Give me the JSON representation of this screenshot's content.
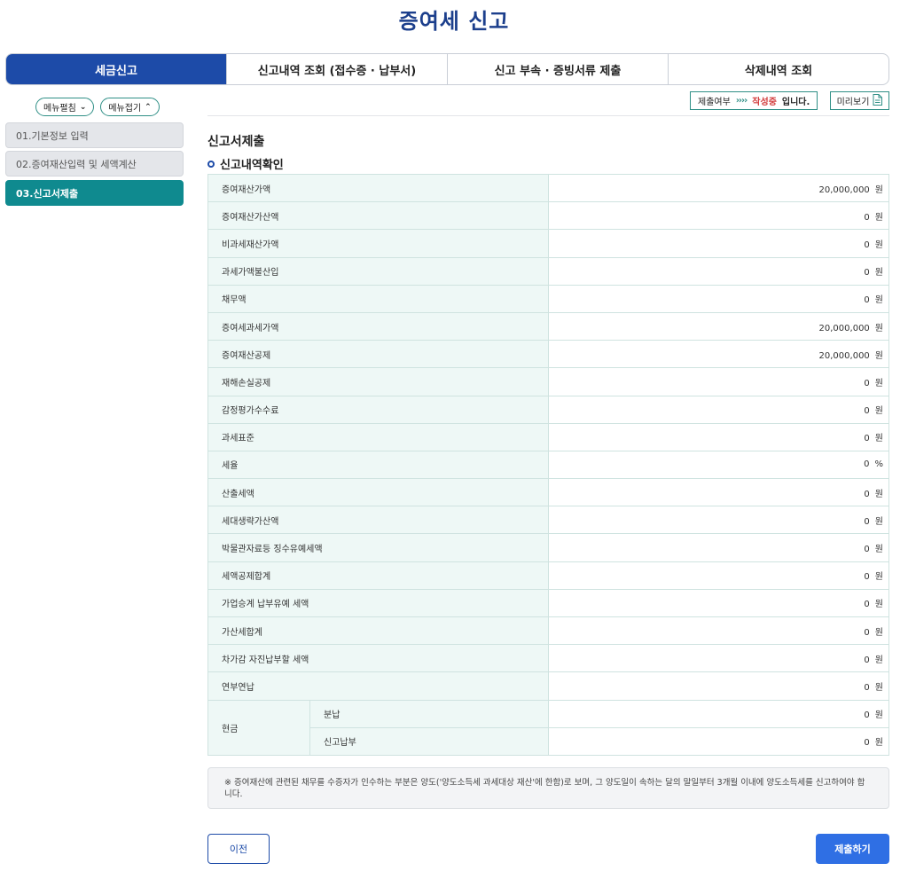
{
  "page_title": "증여세 신고",
  "tabs": [
    {
      "label": "세금신고",
      "active": true
    },
    {
      "label": "신고내역 조회 (접수증 · 납부서)",
      "active": false
    },
    {
      "label": "신고 부속 · 증빙서류 제출",
      "active": false
    },
    {
      "label": "삭제내역 조회",
      "active": false
    }
  ],
  "sidebar": {
    "expand_label": "메뉴펼침",
    "collapse_label": "메뉴접기",
    "items": [
      {
        "label": "01.기본정보 입력",
        "active": false
      },
      {
        "label": "02.증여재산입력 및 세액계산",
        "active": false
      },
      {
        "label": "03.신고서제출",
        "active": true
      }
    ]
  },
  "status": {
    "label": "제출여부",
    "arrows": "››››",
    "state": "작성중",
    "suffix": "입니다."
  },
  "preview_label": "미리보기",
  "section_title": "신고서제출",
  "sub_title": "신고내역확인",
  "rows": [
    {
      "label": "증여재산가액",
      "value": "20,000,000",
      "unit": "원"
    },
    {
      "label": "증여재산가산액",
      "value": "0",
      "unit": "원"
    },
    {
      "label": "비과세재산가액",
      "value": "0",
      "unit": "원"
    },
    {
      "label": "과세가액불산입",
      "value": "0",
      "unit": "원"
    },
    {
      "label": "채무액",
      "value": "0",
      "unit": "원"
    },
    {
      "label": "증여세과세가액",
      "value": "20,000,000",
      "unit": "원"
    },
    {
      "label": "증여재산공제",
      "value": "20,000,000",
      "unit": "원"
    },
    {
      "label": "재해손실공제",
      "value": "0",
      "unit": "원"
    },
    {
      "label": "감정평가수수료",
      "value": "0",
      "unit": "원"
    },
    {
      "label": "과세표준",
      "value": "0",
      "unit": "원"
    },
    {
      "label": "세율",
      "value": "0",
      "unit": "%"
    },
    {
      "label": "산출세액",
      "value": "0",
      "unit": "원"
    },
    {
      "label": "세대생략가산액",
      "value": "0",
      "unit": "원"
    },
    {
      "label": "박물관자료등 징수유예세액",
      "value": "0",
      "unit": "원"
    },
    {
      "label": "세액공제합계",
      "value": "0",
      "unit": "원"
    },
    {
      "label": "가업승계 납부유예 세액",
      "value": "0",
      "unit": "원"
    },
    {
      "label": "가산세합계",
      "value": "0",
      "unit": "원"
    },
    {
      "label": "차가감 자진납부할 세액",
      "value": "0",
      "unit": "원"
    },
    {
      "label": "연부연납",
      "value": "0",
      "unit": "원"
    }
  ],
  "cash_group": {
    "label": "현금",
    "rows": [
      {
        "label": "분납",
        "value": "0",
        "unit": "원"
      },
      {
        "label": "신고납부",
        "value": "0",
        "unit": "원"
      }
    ]
  },
  "notice": "※ 증여재산에 관련된 채무를 수증자가 인수하는 부분은 양도('양도소득세 과세대상 재산'에 한함)로 보며, 그 양도일이 속하는 달의 말일부터 3개월 이내에 양도소득세를 신고하여야 합니다.",
  "buttons": {
    "prev": "이전",
    "submit": "제출하기"
  }
}
